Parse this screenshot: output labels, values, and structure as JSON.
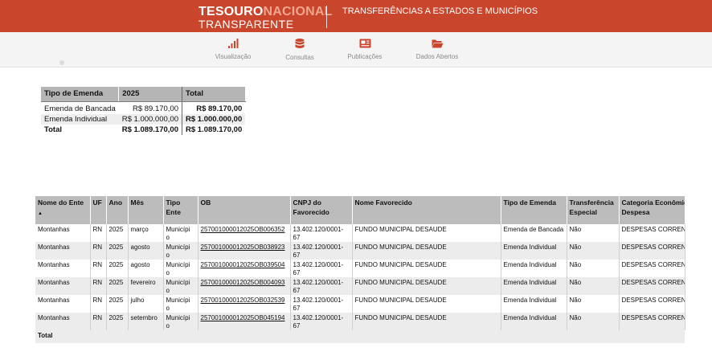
{
  "header": {
    "logo_part1": "TESOURO",
    "logo_part2": "NACIONAL",
    "logo_line2": "TRANSPARENTE",
    "title": "TRANSFERÊNCIAS A ESTADOS E MUNICÍPIOS"
  },
  "colors": {
    "header_bg": "#c9462c",
    "accent_icon": "#c9462c"
  },
  "nav": [
    {
      "label": "Visualização",
      "icon": "bar-chart-icon"
    },
    {
      "label": "Consultas",
      "icon": "database-icon"
    },
    {
      "label": "Publicações",
      "icon": "newspaper-icon"
    },
    {
      "label": "Dados Abertos",
      "icon": "folder-open-icon"
    }
  ],
  "summary": {
    "headers": [
      "Tipo de Emenda",
      "2025",
      "Total"
    ],
    "rows": [
      {
        "tipo": "Emenda de Bancada",
        "year": "R$ 89.170,00",
        "total": "R$ 89.170,00"
      },
      {
        "tipo": "Emenda Individual",
        "year": "R$ 1.000.000,00",
        "total": "R$ 1.000.000,00"
      }
    ],
    "total_row": {
      "label": "Total",
      "year": "R$ 1.089.170,00",
      "total": "R$ 1.089.170,00"
    }
  },
  "detail": {
    "headers": {
      "nome_ente": "Nome do Ente",
      "uf": "UF",
      "ano": "Ano",
      "mes": "Mês",
      "tipo_ente_1": "Tipo",
      "tipo_ente_2": "Ente",
      "ob": "OB",
      "cnpj_1": "CNPJ do",
      "cnpj_2": "Favorecido",
      "nome_fav": "Nome Favorecido",
      "tipo_emenda": "Tipo de Emenda",
      "transf_1": "Transferência",
      "transf_2": "Especial",
      "categoria_1": "Categoria Econômica",
      "categoria_2": "Despesa"
    },
    "rows": [
      {
        "ente": "Montanhas",
        "uf": "RN",
        "ano": "2025",
        "mes": "março",
        "tipo_ente": "Municípi o",
        "ob": "257001000012025OB006352",
        "cnpj": "13.402.120/0001-67",
        "favorecido": "FUNDO MUNICIPAL DESAUDE",
        "tipo_emenda": "Emenda de Bancada",
        "transf": "Não",
        "categoria": "DESPESAS CORRENTES"
      },
      {
        "ente": "Montanhas",
        "uf": "RN",
        "ano": "2025",
        "mes": "agosto",
        "tipo_ente": "Municípi o",
        "ob": "257001000012025OB038923",
        "cnpj": "13.402.120/0001-67",
        "favorecido": "FUNDO MUNICIPAL DESAUDE",
        "tipo_emenda": "Emenda Individual",
        "transf": "Não",
        "categoria": "DESPESAS CORRENTES"
      },
      {
        "ente": "Montanhas",
        "uf": "RN",
        "ano": "2025",
        "mes": "agosto",
        "tipo_ente": "Municípi o",
        "ob": "257001000012025OB039504",
        "cnpj": "13.402.120/0001-67",
        "favorecido": "FUNDO MUNICIPAL DESAUDE",
        "tipo_emenda": "Emenda Individual",
        "transf": "Não",
        "categoria": "DESPESAS CORRENTES"
      },
      {
        "ente": "Montanhas",
        "uf": "RN",
        "ano": "2025",
        "mes": "fevereiro",
        "tipo_ente": "Municípi o",
        "ob": "257001000012025OB004093",
        "cnpj": "13.402.120/0001-67",
        "favorecido": "FUNDO MUNICIPAL DESAUDE",
        "tipo_emenda": "Emenda Individual",
        "transf": "Não",
        "categoria": "DESPESAS CORRENTES"
      },
      {
        "ente": "Montanhas",
        "uf": "RN",
        "ano": "2025",
        "mes": "julho",
        "tipo_ente": "Municípi o",
        "ob": "257001000012025OB032539",
        "cnpj": "13.402.120/0001-67",
        "favorecido": "FUNDO MUNICIPAL DESAUDE",
        "tipo_emenda": "Emenda Individual",
        "transf": "Não",
        "categoria": "DESPESAS CORRENTES"
      },
      {
        "ente": "Montanhas",
        "uf": "RN",
        "ano": "2025",
        "mes": "setembro",
        "tipo_ente": "Municípi o",
        "ob": "257001000012025OB045194",
        "cnpj": "13.402.120/0001-67",
        "favorecido": "FUNDO MUNICIPAL DESAUDE",
        "tipo_emenda": "Emenda Individual",
        "transf": "Não",
        "categoria": "DESPESAS CORRENTES"
      }
    ],
    "total_label": "Total"
  }
}
